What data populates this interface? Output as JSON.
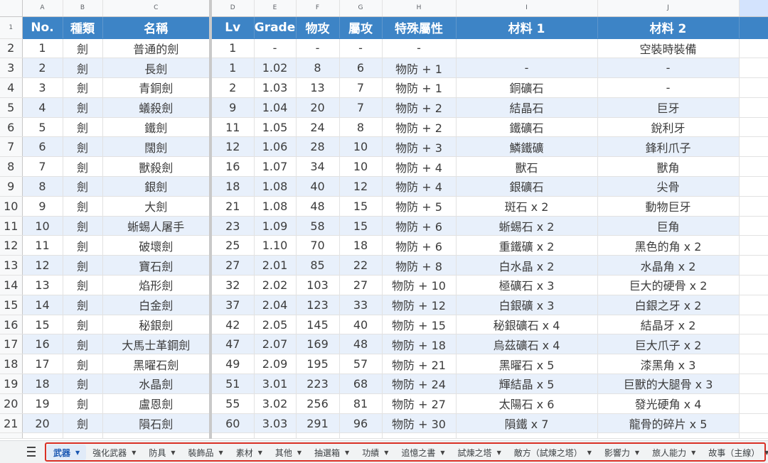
{
  "columns": [
    "A",
    "B",
    "C",
    "D",
    "E",
    "F",
    "G",
    "H",
    "I",
    "J"
  ],
  "header": [
    "No.",
    "種類",
    "名稱",
    "Lv",
    "Grade",
    "物攻",
    "屬攻",
    "特殊屬性",
    "材料 1",
    "材料 2"
  ],
  "rows": [
    [
      "1",
      "劍",
      "普通的劍",
      "1",
      "-",
      "-",
      "-",
      "-",
      "",
      "空裝時裝備"
    ],
    [
      "2",
      "劍",
      "長劍",
      "1",
      "1.02",
      "8",
      "6",
      "物防 + 1",
      "-",
      "-"
    ],
    [
      "3",
      "劍",
      "青銅劍",
      "2",
      "1.03",
      "13",
      "7",
      "物防 + 1",
      "銅礦石",
      "-"
    ],
    [
      "4",
      "劍",
      "蟻殺劍",
      "9",
      "1.04",
      "20",
      "7",
      "物防 + 2",
      "結晶石",
      "巨牙"
    ],
    [
      "5",
      "劍",
      "鐵劍",
      "11",
      "1.05",
      "24",
      "8",
      "物防 + 2",
      "鐵礦石",
      "銳利牙"
    ],
    [
      "6",
      "劍",
      "闊劍",
      "12",
      "1.06",
      "28",
      "10",
      "物防 + 3",
      "鱗鐵礦",
      "鋒利爪子"
    ],
    [
      "7",
      "劍",
      "獸殺劍",
      "16",
      "1.07",
      "34",
      "10",
      "物防 + 4",
      "獸石",
      "獸角"
    ],
    [
      "8",
      "劍",
      "銀劍",
      "18",
      "1.08",
      "40",
      "12",
      "物防 + 4",
      "銀礦石",
      "尖骨"
    ],
    [
      "9",
      "劍",
      "大劍",
      "21",
      "1.08",
      "48",
      "15",
      "物防 + 5",
      "斑石 x 2",
      "動物巨牙"
    ],
    [
      "10",
      "劍",
      "蜥蜴人屠手",
      "23",
      "1.09",
      "58",
      "15",
      "物防 + 6",
      "蜥蜴石 x 2",
      "巨角"
    ],
    [
      "11",
      "劍",
      "破壞劍",
      "25",
      "1.10",
      "70",
      "18",
      "物防 + 6",
      "重鐵礦 x 2",
      "黑色的角 x 2"
    ],
    [
      "12",
      "劍",
      "寶石劍",
      "27",
      "2.01",
      "85",
      "22",
      "物防 + 8",
      "白水晶 x 2",
      "水晶角 x 2"
    ],
    [
      "13",
      "劍",
      "焰形劍",
      "32",
      "2.02",
      "103",
      "27",
      "物防 + 10",
      "極礦石 x 3",
      "巨大的硬骨 x 2"
    ],
    [
      "14",
      "劍",
      "白金劍",
      "37",
      "2.04",
      "123",
      "33",
      "物防 + 12",
      "白銀礦 x 3",
      "白銀之牙 x 2"
    ],
    [
      "15",
      "劍",
      "秘銀劍",
      "42",
      "2.05",
      "145",
      "40",
      "物防 + 15",
      "秘銀礦石 x 4",
      "結晶牙 x 2"
    ],
    [
      "16",
      "劍",
      "大馬士革鋼劍",
      "47",
      "2.07",
      "169",
      "48",
      "物防 + 18",
      "烏茲礦石 x 4",
      "巨大爪子 x 2"
    ],
    [
      "17",
      "劍",
      "黑曜石劍",
      "49",
      "2.09",
      "195",
      "57",
      "物防 + 21",
      "黑曜石 x 5",
      "漆黑角 x 3"
    ],
    [
      "18",
      "劍",
      "水晶劍",
      "51",
      "3.01",
      "223",
      "68",
      "物防 + 24",
      "輝結晶 x 5",
      "巨獸的大腿骨 x 3"
    ],
    [
      "19",
      "劍",
      "盧恩劍",
      "55",
      "3.02",
      "256",
      "81",
      "物防 + 27",
      "太陽石 x 6",
      "發光硬角 x 4"
    ],
    [
      "20",
      "劍",
      "隕石劍",
      "60",
      "3.03",
      "291",
      "96",
      "物防 + 30",
      "隕鐵 x 7",
      "龍骨的碎片 x 5"
    ]
  ],
  "tabs": [
    "武器",
    "強化武器",
    "防具",
    "裝飾品",
    "素材",
    "其他",
    "抽選箱",
    "功績",
    "追憶之書",
    "試煉之塔",
    "敵方（試煉之塔）",
    "影響力",
    "旅人能力",
    "故事（主線）"
  ],
  "caret": "▼",
  "colors": {
    "header_bg": "#3d84c6",
    "band_bg": "#e8f0fb",
    "active_tab": "#1a57b2",
    "frame": "#d93025"
  }
}
